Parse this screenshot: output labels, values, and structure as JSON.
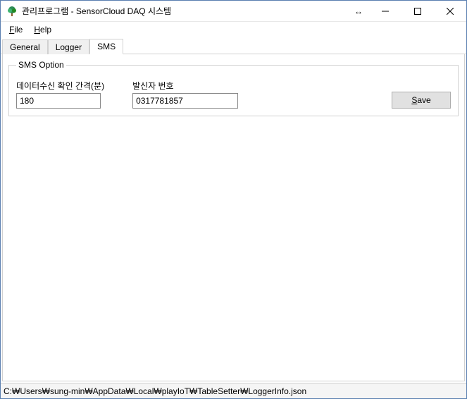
{
  "titlebar": {
    "title": "관리프로그램 - SensorCloud DAQ 시스템"
  },
  "menu": {
    "file_pre": "F",
    "file_rest": "ile",
    "help_pre": "H",
    "help_rest": "elp"
  },
  "tabs": {
    "general": "General",
    "logger": "Logger",
    "sms": "SMS"
  },
  "group": {
    "legend": "SMS Option",
    "interval_label": "데이터수신 확인 간격(분)",
    "interval_value": "180",
    "sender_label": "발신자 번호",
    "sender_value": "0317781857",
    "save_pre": "S",
    "save_rest": "ave"
  },
  "statusbar": {
    "path": "C:₩Users₩sung-min₩AppData₩Local₩playIoT₩TableSetter₩LoggerInfo.json"
  }
}
